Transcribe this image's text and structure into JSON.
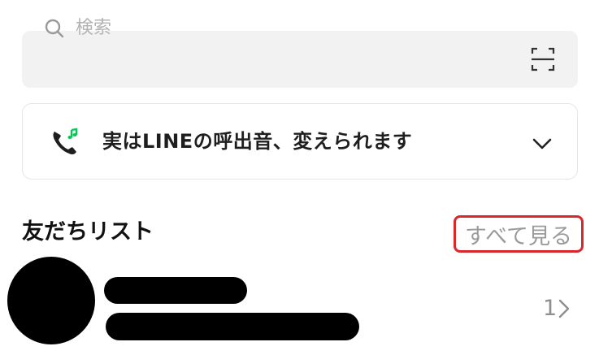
{
  "search": {
    "placeholder": "検索",
    "icon": "search-icon",
    "scan_icon": "qr-scan-icon"
  },
  "banner": {
    "text": "実はLINEの呼出音、変えられます",
    "icon": "phone-music-icon",
    "expand_icon": "chevron-down-icon",
    "accent_color": "#06c755"
  },
  "friends": {
    "title": "友だちリスト",
    "see_all_label": "すべて見る",
    "count": "1",
    "highlight_color": "#d9272e"
  }
}
